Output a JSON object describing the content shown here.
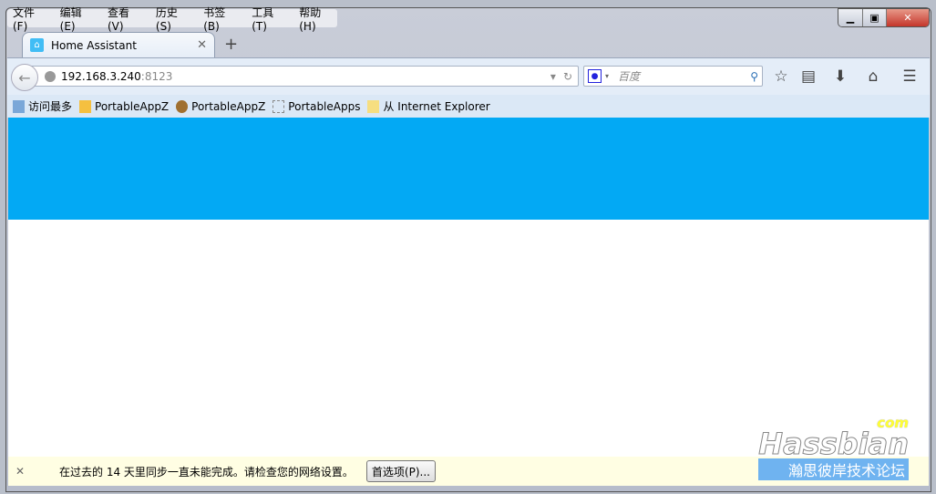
{
  "menu": [
    "文件(F)",
    "编辑(E)",
    "查看(V)",
    "历史(S)",
    "书签(B)",
    "工具(T)",
    "帮助(H)"
  ],
  "tab": {
    "title": "Home Assistant"
  },
  "url": {
    "host": "192.168.3.240",
    "port": ":8123"
  },
  "search": {
    "placeholder": "百度"
  },
  "bookmarks": [
    "访问最多",
    "PortableAppZ",
    "PortableAppZ",
    "PortableApps",
    "从 Internet Explorer"
  ],
  "notification": {
    "message": "在过去的 14 天里同步一直未能完成。请检查您的网络设置。",
    "button": "首选项(P)..."
  },
  "watermark": {
    "com": "com",
    "name": "Hassbian",
    "subtitle": "瀚思彼岸技术论坛"
  },
  "colors": {
    "header": "#03a9f4"
  }
}
